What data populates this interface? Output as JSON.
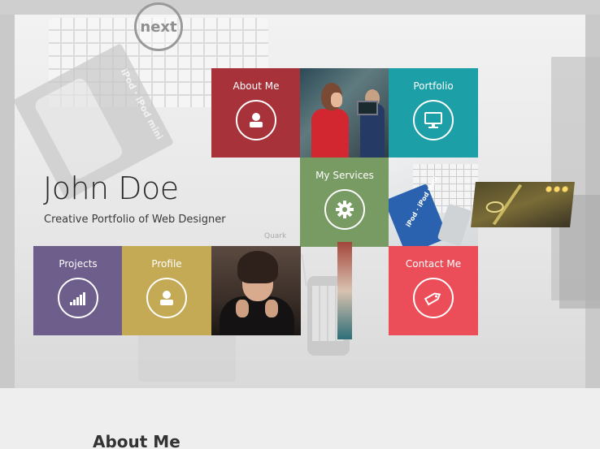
{
  "logo": {
    "text": "next"
  },
  "hero": {
    "name": "John Doe",
    "tagline": "Creative Portfolio of Web Designer",
    "background_caption": "Quark",
    "box_label": "iPod · iPod mini",
    "desk_box_label": "iPod · iPod mini"
  },
  "tiles": {
    "about": {
      "label": "About Me",
      "color": "#a8323a",
      "icon": "user-icon"
    },
    "portfolio": {
      "label": "Portfolio",
      "color": "#1c9fa7",
      "icon": "monitor-icon"
    },
    "services": {
      "label": "My Services",
      "color": "#789a63",
      "icon": "gear-icon"
    },
    "projects": {
      "label": "Projects",
      "color": "#6e5e8c",
      "icon": "signal-bars-icon"
    },
    "profile": {
      "label": "Profile",
      "color": "#c5aa56",
      "icon": "user-icon"
    },
    "contact": {
      "label": "Contact Me",
      "color": "#eb4e58",
      "icon": "tag-icon"
    }
  },
  "sections": {
    "about_heading": "About Me"
  }
}
